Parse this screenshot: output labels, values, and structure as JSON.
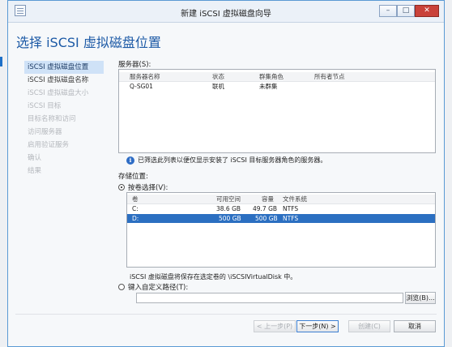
{
  "window": {
    "title": "新建 iSCSI 虚拟磁盘向导",
    "min_label": "–",
    "max_label": "□",
    "close_label": "✕"
  },
  "page": {
    "heading": "选择 iSCSI 虚拟磁盘位置"
  },
  "nav": {
    "items": [
      {
        "label": "iSCSI 虚拟磁盘位置",
        "state": "selected"
      },
      {
        "label": "iSCSI 虚拟磁盘名称",
        "state": "enabled"
      },
      {
        "label": "iSCSI 虚拟磁盘大小",
        "state": "disabled"
      },
      {
        "label": "iSCSI 目标",
        "state": "disabled"
      },
      {
        "label": "目标名称和访问",
        "state": "disabled"
      },
      {
        "label": "访问服务器",
        "state": "disabled"
      },
      {
        "label": "启用验证服务",
        "state": "disabled"
      },
      {
        "label": "确认",
        "state": "disabled"
      },
      {
        "label": "结果",
        "state": "disabled"
      }
    ]
  },
  "servers": {
    "label": "服务器(S):",
    "columns": [
      "服务器名称",
      "状态",
      "群集角色",
      "所有者节点"
    ],
    "rows": [
      [
        "Q-SG01",
        "联机",
        "未群集",
        ""
      ]
    ]
  },
  "info_text": "已筛选此列表以便仅显示安装了 iSCSI 目标服务器角色的服务器。",
  "storage": {
    "label": "存储位置:",
    "by_volume_label": "按卷选择(V):",
    "columns": [
      "卷",
      "可用空间",
      "容量",
      "文件系统"
    ],
    "rows": [
      {
        "cells": [
          "C:",
          "38.6 GB",
          "49.7 GB",
          "NTFS"
        ],
        "selected": false
      },
      {
        "cells": [
          "D:",
          "500 GB",
          "500 GB",
          "NTFS"
        ],
        "selected": true
      }
    ],
    "save_note": "iSCSI 虚拟磁盘将保存在选定卷的 \\iSCSIVirtualDisk 中。",
    "custom_path_label": "键入自定义路径(T):",
    "custom_path_value": "",
    "browse_label": "浏览(B)..."
  },
  "buttons": {
    "prev": "< 上一步(P)",
    "next": "下一步(N) >",
    "create": "创建(C)",
    "cancel": "取消"
  }
}
